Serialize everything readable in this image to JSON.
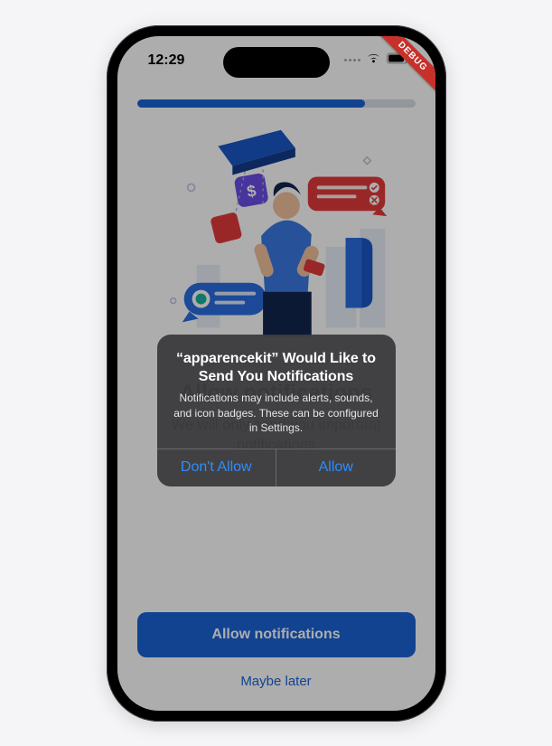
{
  "status": {
    "time": "12:29"
  },
  "debug": {
    "label": "DEBUG"
  },
  "progress": {
    "percent": 82
  },
  "page": {
    "title": "Allow notifications",
    "subtitle": "We will only send you important notifications",
    "primary_button": "Allow notifications",
    "secondary_link": "Maybe later"
  },
  "alert": {
    "title": "“apparencekit” Would Like to Send You Notifications",
    "message": "Notifications may include alerts, sounds, and icon badges. These can be configured in Settings.",
    "dont_allow": "Don't Allow",
    "allow": "Allow"
  },
  "colors": {
    "accent": "#1a63d6",
    "ios_blue": "#2e8cff",
    "debug_red": "#c6322b"
  }
}
